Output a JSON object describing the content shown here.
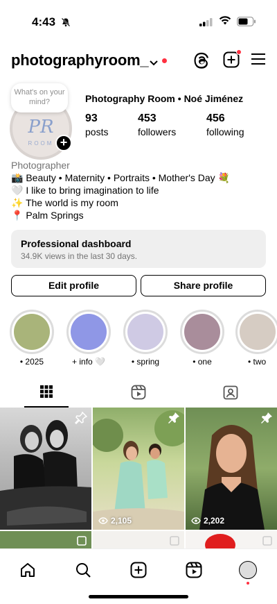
{
  "status_bar": {
    "time": "4:43",
    "icons": [
      "bell-slash-icon",
      "signal-icon",
      "wifi-icon",
      "battery-icon"
    ]
  },
  "header": {
    "username": "photographyroom_",
    "icons": [
      "chevron-down-icon",
      "threads-icon",
      "create-icon",
      "menu-icon"
    ],
    "accent": "#ff3040"
  },
  "profile": {
    "note_bubble": "What's on your mind?",
    "avatar_initials": "PR",
    "avatar_caption": "ROOM",
    "full_name": "Photography Room • Noé Jiménez",
    "stats": [
      {
        "number": "93",
        "label": "posts"
      },
      {
        "number": "453",
        "label": "followers"
      },
      {
        "number": "456",
        "label": "following"
      }
    ]
  },
  "bio": {
    "category": "Photographer",
    "lines": [
      "📸 Beauty • Maternity • Portraits • Mother's Day 💐",
      "🤍 I like to bring imagination to life",
      "✨ The world is my room",
      "📍 Palm Springs"
    ]
  },
  "dashboard": {
    "title": "Professional dashboard",
    "subtitle": "34.9K views in the last 30 days."
  },
  "buttons": {
    "edit": "Edit profile",
    "share": "Share profile"
  },
  "highlights": [
    {
      "label": "• 2025",
      "color": "#a9b47a"
    },
    {
      "label": "+ info 🤍",
      "color": "#8f97e6"
    },
    {
      "label": "• spring",
      "color": "#cfcae4"
    },
    {
      "label": "• one",
      "color": "#a98d9b"
    },
    {
      "label": "• two",
      "color": "#d6ccc3"
    }
  ],
  "tabs": [
    "grid-icon",
    "reels-icon",
    "tagged-icon"
  ],
  "posts": [
    {
      "views": "",
      "pinned": true
    },
    {
      "views": "2,105",
      "pinned": true
    },
    {
      "views": "2,202",
      "pinned": true
    }
  ],
  "bottom_nav": [
    "home-icon",
    "search-icon",
    "create-icon",
    "reels-icon",
    "profile-avatar"
  ]
}
